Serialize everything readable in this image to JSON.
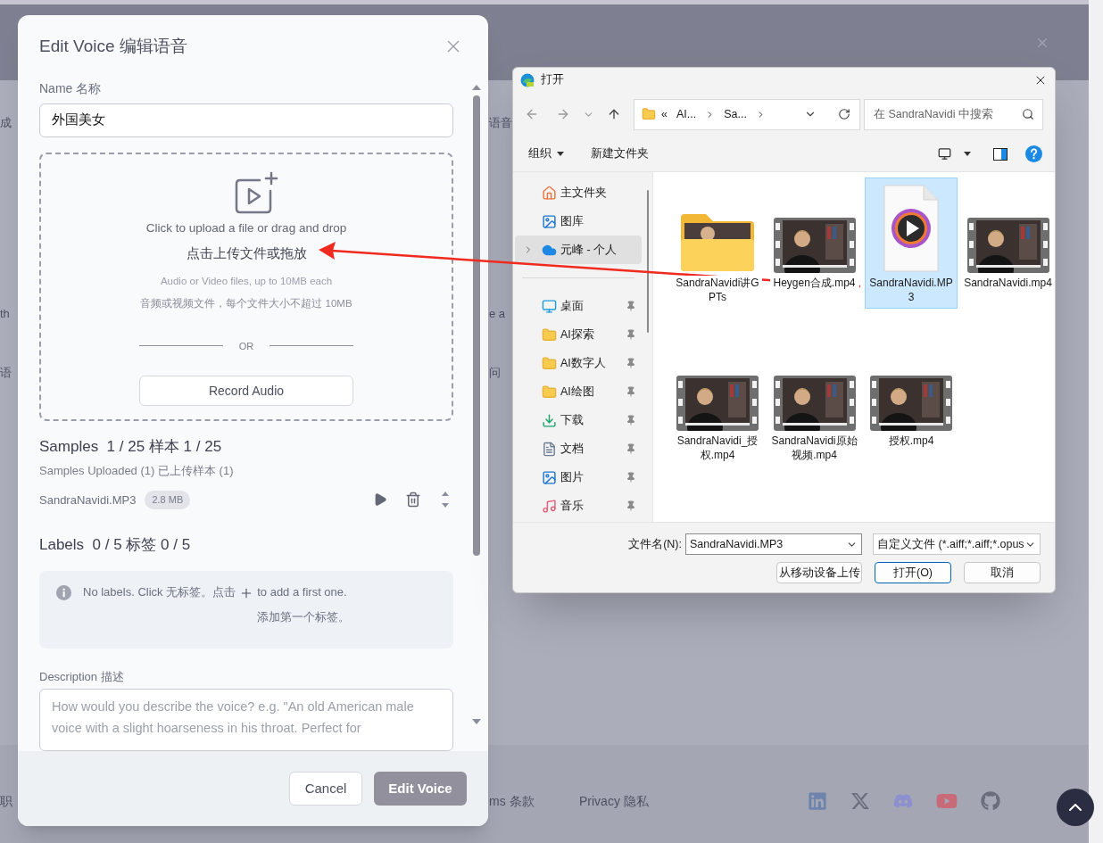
{
  "background": {
    "rows": [
      {
        "left": "成",
        "right": "语音"
      },
      {
        "left": "th",
        "right": "e a"
      },
      {
        "left": "语",
        "right": "问"
      }
    ],
    "footer": {
      "left": "职",
      "links": [
        "ms 条款",
        "Privacy 隐私"
      ]
    }
  },
  "modal": {
    "title": "Edit Voice 编辑语音",
    "name_label": "Name 名称",
    "name_value": "外国美女",
    "upload": {
      "line1": "Click to upload a file or drag and drop",
      "line2": "点击上传文件或拖放",
      "hint1": "Audio or Video files, up to 10MB each",
      "hint2": "音频或视频文件，每个文件大小不超过 10MB",
      "divider": "OR",
      "record_button": "Record Audio"
    },
    "samples": {
      "heading": "Samples  1 / 25 样本 1 / 25",
      "uploaded": "Samples Uploaded (1) 已上传样本 (1)",
      "files": [
        {
          "name": "SandraNavidi.MP3",
          "size": "2.8 MB"
        }
      ]
    },
    "labels": {
      "heading": "Labels  0 / 5 标签 0 / 5",
      "empty_before": "No labels. Click 无标签。点击",
      "empty_after": "to add a first one.",
      "empty_after_2": "添加第一个标签。"
    },
    "description": {
      "label": "Description 描述",
      "placeholder": "How would you describe the voice? e.g. \"An old American male voice with a slight hoarseness in his throat. Perfect for"
    },
    "buttons": [
      {
        "label": "Cancel",
        "kind": "secondary"
      },
      {
        "label": "Edit Voice",
        "kind": "primary"
      }
    ]
  },
  "file_dialog": {
    "title": "打开",
    "address": [
      "«",
      "AI...",
      "Sa..."
    ],
    "search_placeholder": "在 SandraNavidi 中搜索",
    "toolbar": [
      {
        "label": "组织",
        "dropdown": true
      },
      {
        "label": "新建文件夹",
        "dropdown": false
      }
    ],
    "sidebar": [
      {
        "items": [
          {
            "label": "主文件夹",
            "kind": "home",
            "selected": false,
            "expandable": false,
            "pinned": false
          },
          {
            "label": "图库",
            "kind": "gallery",
            "selected": false,
            "expandable": false,
            "pinned": false
          },
          {
            "label": "元峰 - 个人",
            "kind": "cloud",
            "selected": true,
            "expandable": true,
            "pinned": false
          }
        ]
      },
      {
        "items": [
          {
            "label": "桌面",
            "kind": "desktop",
            "selected": false,
            "expandable": false,
            "pinned": true
          },
          {
            "label": "AI探索",
            "kind": "folder",
            "selected": false,
            "expandable": false,
            "pinned": true
          },
          {
            "label": "AI数字人",
            "kind": "folder",
            "selected": false,
            "expandable": false,
            "pinned": true
          },
          {
            "label": "AI绘图",
            "kind": "folder",
            "selected": false,
            "expandable": false,
            "pinned": true
          },
          {
            "label": "下载",
            "kind": "download",
            "selected": false,
            "expandable": false,
            "pinned": true
          },
          {
            "label": "文档",
            "kind": "document",
            "selected": false,
            "expandable": false,
            "pinned": true
          },
          {
            "label": "图片",
            "kind": "pictures",
            "selected": false,
            "expandable": false,
            "pinned": true
          },
          {
            "label": "音乐",
            "kind": "music",
            "selected": false,
            "expandable": false,
            "pinned": true
          }
        ]
      }
    ],
    "files": [
      {
        "name": "SandraNavidi讲GPTs",
        "kind": "folder",
        "selected": false
      },
      {
        "name": "Heygen合成.mp4",
        "kind": "video",
        "selected": false
      },
      {
        "name": "SandraNavidi.MP3",
        "kind": "audio",
        "selected": true
      },
      {
        "name": "SandraNavidi.mp4",
        "kind": "video",
        "selected": false
      },
      {
        "name": "SandraNavidi_授权.mp4",
        "kind": "video",
        "selected": false
      },
      {
        "name": "SandraNavidi原始视频.mp4",
        "kind": "video",
        "selected": false
      },
      {
        "name": "授权.mp4",
        "kind": "video",
        "selected": false
      }
    ],
    "filename_label": "文件名(N):",
    "filename_value": "SandraNavidi.MP3",
    "filter": "自定义文件 (*.aiff;*.aiff;*.opus",
    "buttons": [
      {
        "label": "从移动设备上传",
        "kind": "normal"
      },
      {
        "label": "打开(O)",
        "kind": "default"
      },
      {
        "label": "取消",
        "kind": "normal"
      }
    ]
  }
}
